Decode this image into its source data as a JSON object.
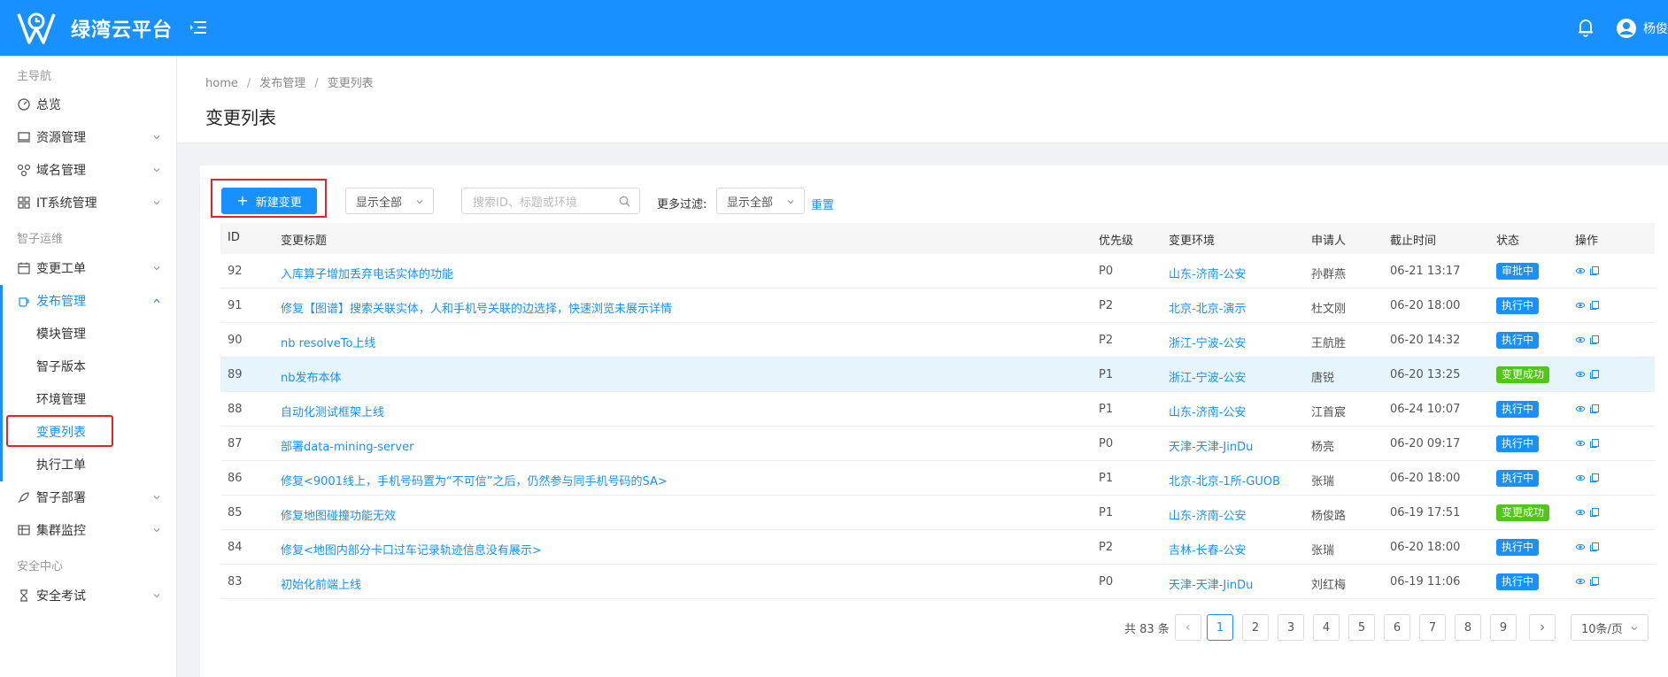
{
  "header": {
    "brand": "绿湾云平台",
    "user_name": "杨俊"
  },
  "sidebar": {
    "group_main": "主导航",
    "group_ops": "智子运维",
    "group_security": "安全中心",
    "items": {
      "overview": "总览",
      "resources": "资源管理",
      "domains": "域名管理",
      "it_systems": "IT系统管理",
      "change_orders": "变更工单",
      "release": "发布管理",
      "deploy": "智子部署",
      "cluster": "集群监控",
      "exam": "安全考试"
    },
    "release_sub": [
      "模块管理",
      "智子版本",
      "环境管理",
      "变更列表",
      "执行工单"
    ]
  },
  "breadcrumb": [
    "home",
    "发布管理",
    "变更列表"
  ],
  "page_title": "变更列表",
  "toolbar": {
    "new_button": "新建变更",
    "filter_select": "显示全部",
    "search_placeholder": "搜索ID、标题或环境",
    "more_filter_label": "更多过滤:",
    "more_filter_select": "显示全部",
    "reset": "重置"
  },
  "table": {
    "columns": [
      "ID",
      "变更标题",
      "优先级",
      "变更环境",
      "申请人",
      "截止时间",
      "状态",
      "操作"
    ],
    "rows": [
      {
        "id": "92",
        "title": "入库算子增加丢弃电话实体的功能",
        "priority": "P0",
        "env": "山东-济南-公安",
        "applicant": "孙群燕",
        "deadline": "06-21 13:17",
        "status": "审批中"
      },
      {
        "id": "91",
        "title": "修复【图谱】搜索关联实体，人和手机号关联的边选择，快速浏览未展示详情",
        "priority": "P2",
        "env": "北京-北京-演示",
        "applicant": "杜文刚",
        "deadline": "06-20 18:00",
        "status": "执行中"
      },
      {
        "id": "90",
        "title": "nb resolveTo上线",
        "priority": "P2",
        "env": "浙江-宁波-公安",
        "applicant": "王航胜",
        "deadline": "06-20 14:32",
        "status": "执行中"
      },
      {
        "id": "89",
        "title": "nb发布本体",
        "priority": "P1",
        "env": "浙江-宁波-公安",
        "applicant": "唐锐",
        "deadline": "06-20 13:25",
        "status": "变更成功"
      },
      {
        "id": "88",
        "title": "自动化测试框架上线",
        "priority": "P1",
        "env": "山东-济南-公安",
        "applicant": "江首宸",
        "deadline": "06-24 10:07",
        "status": "执行中"
      },
      {
        "id": "87",
        "title": "部署data-mining-server",
        "priority": "P0",
        "env": "天津-天津-JinDu",
        "applicant": "杨亮",
        "deadline": "06-20 09:17",
        "status": "执行中"
      },
      {
        "id": "86",
        "title": "修复<9001线上，手机号码置为“不可信”之后，仍然参与同手机号码的SA>",
        "priority": "P1",
        "env": "北京-北京-1所-GUOB",
        "applicant": "张瑞",
        "deadline": "06-20 18:00",
        "status": "执行中"
      },
      {
        "id": "85",
        "title": "修复地图碰撞功能无效",
        "priority": "P1",
        "env": "山东-济南-公安",
        "applicant": "杨俊路",
        "deadline": "06-19 17:51",
        "status": "变更成功"
      },
      {
        "id": "84",
        "title": "修复<地图内部分卡口过车记录轨迹信息没有展示>",
        "priority": "P2",
        "env": "吉林-长春-公安",
        "applicant": "张瑞",
        "deadline": "06-20 18:00",
        "status": "执行中"
      },
      {
        "id": "83",
        "title": "初始化前端上线",
        "priority": "P0",
        "env": "天津-天津-JinDu",
        "applicant": "刘红梅",
        "deadline": "06-19 11:06",
        "status": "执行中"
      }
    ]
  },
  "status_colors": {
    "审批中": "#1890ff",
    "执行中": "#1890ff",
    "变更成功": "#52c41a"
  },
  "pagination": {
    "total": "共 83 条",
    "pages": [
      "1",
      "2",
      "3",
      "4",
      "5",
      "6",
      "7",
      "8",
      "9"
    ],
    "current": "1",
    "page_size": "10条/页"
  }
}
